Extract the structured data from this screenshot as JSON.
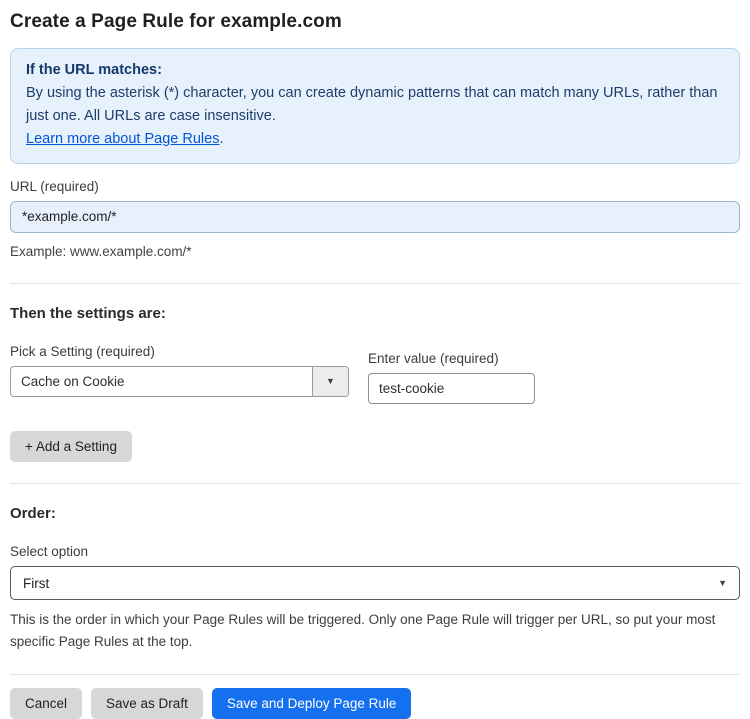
{
  "page": {
    "title": "Create a Page Rule for example.com"
  },
  "info_box": {
    "heading": "If the URL matches:",
    "body": "By using the asterisk (*) character, you can create dynamic patterns that can match many URLs, rather than just one. All URLs are case insensitive.",
    "link_label": "Learn more about Page Rules",
    "link_suffix": "."
  },
  "url_field": {
    "label": "URL (required)",
    "value": "*example.com/*",
    "helper": "Example: www.example.com/*"
  },
  "settings_section": {
    "heading": "Then the settings are:",
    "setting_select": {
      "label": "Pick a Setting (required)",
      "value": "Cache on Cookie"
    },
    "value_field": {
      "label": "Enter value (required)",
      "value": "test-cookie"
    },
    "add_setting_label": "+ Add a Setting",
    "dropdown_arrow": "▼"
  },
  "order_section": {
    "heading": "Order:",
    "select_label": "Select option",
    "select_value": "First",
    "dropdown_arrow": "▼",
    "helper": "This is the order in which your Page Rules will be triggered. Only one Page Rule will trigger per URL, so put your most specific Page Rules at the top."
  },
  "footer": {
    "cancel_label": "Cancel",
    "save_draft_label": "Save as Draft",
    "save_deploy_label": "Save and Deploy Page Rule"
  },
  "colors": {
    "accent_blue": "#1570ef",
    "info_bg": "#e7f1fb",
    "info_border": "#b8d3ee",
    "info_text": "#1d3d6d",
    "link_blue": "#0055dc",
    "url_input_bg": "#e8f0fd"
  }
}
